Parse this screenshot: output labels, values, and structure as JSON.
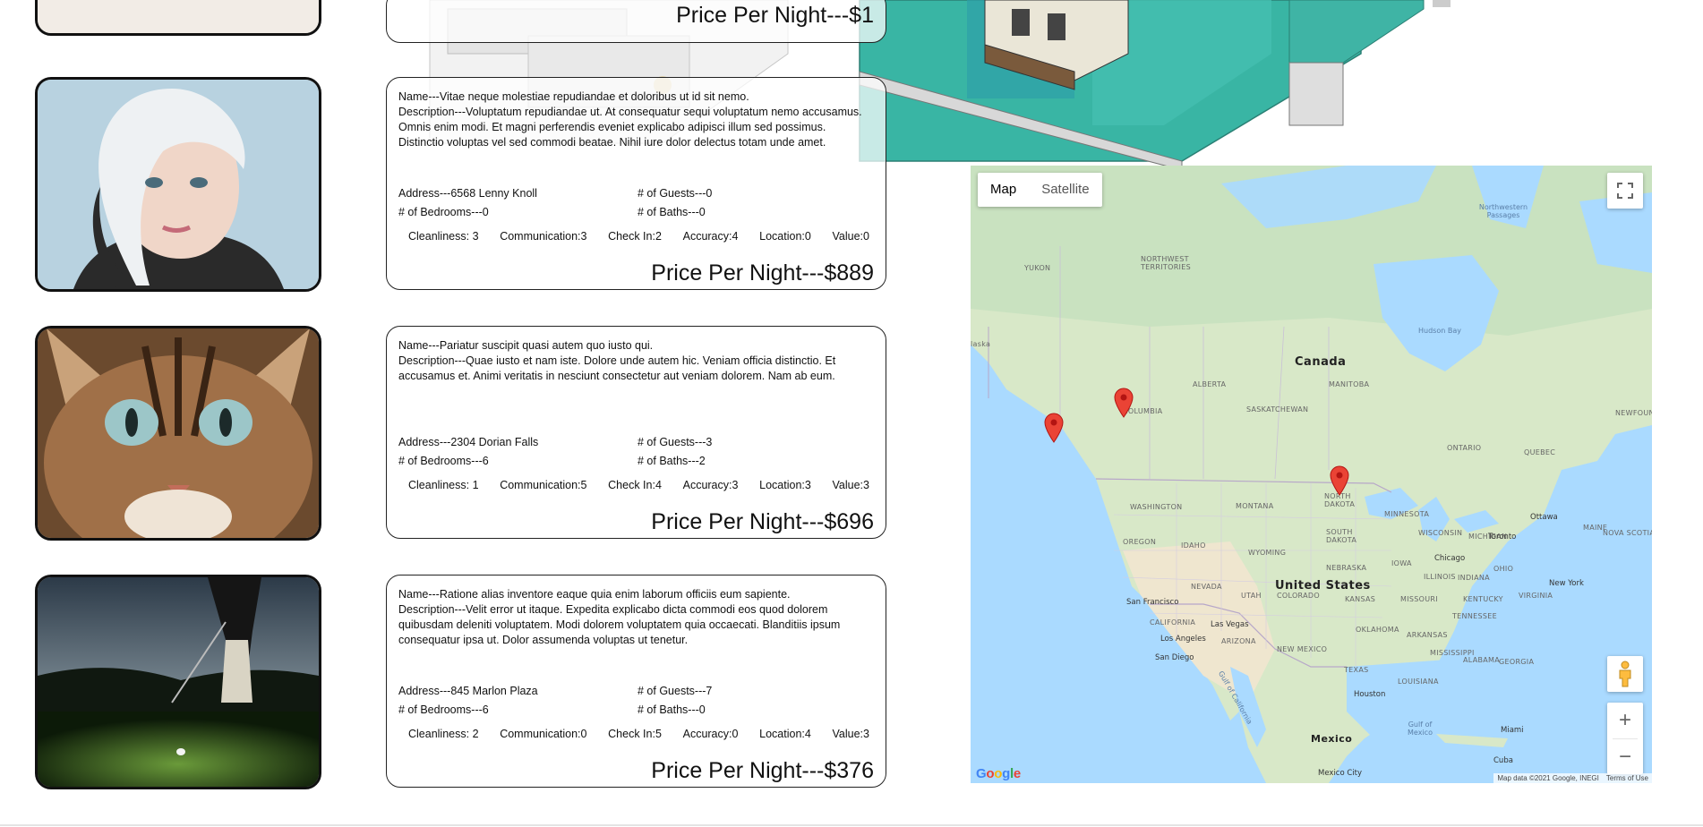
{
  "listings": [
    {
      "price": "Price Per Night---$1"
    },
    {
      "image_icon": "woman-portrait",
      "name": "Name---Vitae neque molestiae repudiandae et doloribus ut id sit nemo.",
      "description": "Description---Voluptatum repudiandae ut. At consequatur sequi voluptatum nemo accusamus. Omnis enim modi. Et magni perferendis eveniet explicabo adipisci illum sed possimus. Distinctio voluptas vel sed commodi beatae. Nihil iure dolor delectus totam unde amet.",
      "address": "Address---6568 Lenny Knoll",
      "bedrooms": "# of Bedrooms---0",
      "guests": "# of Guests---0",
      "baths": "# of Baths---0",
      "ratings": [
        "Cleanliness: 3",
        "Communication:3",
        "Check In:2",
        "Accuracy:4",
        "Location:0",
        "Value:0"
      ],
      "price": "Price Per Night---$889"
    },
    {
      "image_icon": "cat-face",
      "name": "Name---Pariatur suscipit quasi autem quo iusto qui.",
      "description": "Description---Quae iusto et nam iste. Dolore unde autem hic. Veniam officia distinctio. Et accusamus et. Animi veritatis in nesciunt consectetur aut veniam dolorem. Nam ab eum.",
      "address": "Address---2304 Dorian Falls",
      "bedrooms": "# of Bedrooms---6",
      "guests": "# of Guests---3",
      "baths": "# of Baths---2",
      "ratings": [
        "Cleanliness: 1",
        "Communication:5",
        "Check In:4",
        "Accuracy:3",
        "Location:3",
        "Value:3"
      ],
      "price": "Price Per Night---$696"
    },
    {
      "image_icon": "golfer-night",
      "name": "Name---Ratione alias inventore eaque quia enim laborum officiis eum sapiente.",
      "description": "Description---Velit error ut itaque. Expedita explicabo dicta commodi eos quod dolorem quibusdam deleniti voluptatem. Modi dolorem voluptatem quia occaecati. Blanditiis ipsum consequatur ipsa ut. Dolor assumenda voluptas ut tenetur.",
      "address": "Address---845 Marlon Plaza",
      "bedrooms": "# of Bedrooms---6",
      "guests": "# of Guests---7",
      "baths": "# of Baths---0",
      "ratings": [
        "Cleanliness: 2",
        "Communication:0",
        "Check In:5",
        "Accuracy:0",
        "Location:4",
        "Value:3"
      ],
      "price": "Price Per Night---$376"
    }
  ],
  "map": {
    "map_type_options": [
      "Map",
      "Satellite"
    ],
    "selected_map_type": "Map",
    "fullscreen_icon": "fullscreen-icon",
    "pegman_icon": "pegman-icon",
    "zoom_in_label": "+",
    "zoom_out_label": "−",
    "logo": "Google",
    "attribution": "Map data ©2021 Google, INEGI",
    "terms": "Terms of Use",
    "labels": {
      "canada": "Canada",
      "united_states": "United States",
      "mexico": "Mexico",
      "yukon": "YUKON",
      "nwt": "NORTHWEST TERRITORIES",
      "alaska": "laska",
      "alberta": "ALBERTA",
      "manitoba": "MANITOBA",
      "saskatchewan": "SASKATCHEWAN",
      "columbia": "COLUMBIA",
      "ontario": "ONTARIO",
      "quebec": "QUEBEC",
      "washington": "WASHINGTON",
      "montana": "MONTANA",
      "north_dakota": "NORTH DAKOTA",
      "south_dakota": "SOUTH DAKOTA",
      "minnesota": "MINNESOTA",
      "wisconsin": "WISCONSIN",
      "michigan": "MICHIGAN",
      "oregon": "OREGON",
      "idaho": "IDAHO",
      "wyoming": "WYOMING",
      "nebraska": "NEBRASKA",
      "iowa": "IOWA",
      "nevada": "NEVADA",
      "utah": "UTAH",
      "colorado": "COLORADO",
      "kansas": "KANSAS",
      "missouri": "MISSOURI",
      "illinois": "ILLINOIS",
      "indiana": "INDIANA",
      "ohio": "OHIO",
      "california": "CALIFORNIA",
      "arizona": "ARIZONA",
      "new_mexico": "NEW MEXICO",
      "oklahoma": "OKLAHOMA",
      "arkansas": "ARKANSAS",
      "tennessee": "TENNESSEE",
      "texas": "TEXAS",
      "louisiana": "LOUISIANA",
      "mississippi": "MISSISSIPPI",
      "alabama": "ALABAMA",
      "georgia": "GEORGIA",
      "kentucky": "KENTUCKY",
      "virginia": "VIRGINIA",
      "nova_scotia": "NOVA SCOTIA",
      "newfoundland": "NEWFOUND",
      "maine": "MAINE",
      "hudson_bay": "Hudson Bay",
      "nw_passages": "Northwestern Passages",
      "gulf_california": "Gulf of California",
      "gulf_mexico": "Gulf of Mexico",
      "san_francisco": "San Francisco",
      "las_vegas": "Las Vegas",
      "los_angeles": "Los Angeles",
      "san_diego": "San Diego",
      "chicago": "Chicago",
      "toronto": "Toronto",
      "ottawa": "Ottawa",
      "new_york": "New York",
      "houston": "Houston",
      "miami": "Miami",
      "cuba": "Cuba",
      "mexico_city": "Mexico City"
    }
  }
}
